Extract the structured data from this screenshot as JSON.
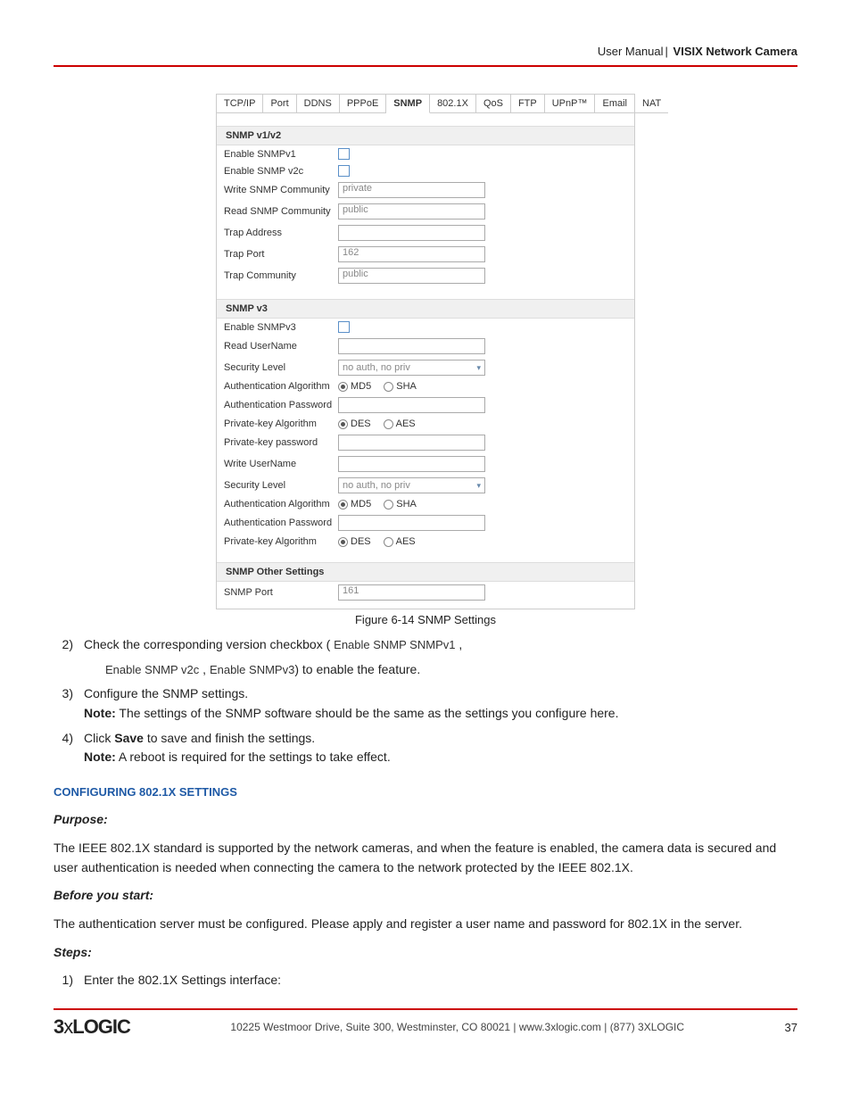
{
  "header": {
    "left": "User Manual",
    "sep": "|",
    "right": "VISIX Network Camera"
  },
  "tabs": [
    "TCP/IP",
    "Port",
    "DDNS",
    "PPPoE",
    "SNMP",
    "802.1X",
    "QoS",
    "FTP",
    "UPnP™",
    "Email",
    "NAT"
  ],
  "active_tab": "SNMP",
  "panel": {
    "s1": {
      "title": "SNMP v1/v2",
      "r1": "Enable SNMPv1",
      "r2": "Enable SNMP v2c",
      "r3": "Write SNMP Community",
      "v3": "private",
      "r4": "Read SNMP Community",
      "v4": "public",
      "r5": "Trap Address",
      "r6": "Trap Port",
      "v6": "162",
      "r7": "Trap Community",
      "v7": "public"
    },
    "s2": {
      "title": "SNMP v3",
      "r1": "Enable SNMPv3",
      "r2": "Read UserName",
      "r3": "Security Level",
      "v3": "no auth, no priv",
      "r4": "Authentication Algorithm",
      "a": "MD5",
      "b": "SHA",
      "r5": "Authentication Password",
      "r6": "Private-key Algorithm",
      "c": "DES",
      "d": "AES",
      "r7": "Private-key password",
      "r8": "Write UserName",
      "r9": "Security Level",
      "v9": "no auth, no priv",
      "r10": "Authentication Algorithm",
      "r11": "Authentication Password",
      "r12": "Private-key Algorithm"
    },
    "s3": {
      "title": "SNMP Other Settings",
      "r1": "SNMP Port",
      "v1": "161"
    }
  },
  "caption_pre": "Figure 6-14 ",
  "caption": "SNMP Settings",
  "li2a": "Check the corresponding version checkbox ( ",
  "li2_img1": "Enable SNMP SNMPv1",
  "li2b": " ,",
  "li2_line2_img1": "Enable SNMP v2c",
  "li2_line2_sep": " ,     ",
  "li2_line2_img2": "Enable SNMPv3",
  "li2_line2_end": ") to enable the feature.",
  "li3": "Configure the SNMP settings.",
  "note_label": "Note:",
  "li3_note": " The settings of the SNMP software should be the same as the settings you configure here.",
  "li4_a": "Click ",
  "li4_b": "Save",
  "li4_c": " to save and finish the settings.",
  "li4_note": " A reboot is required for the settings to take effect.",
  "sect": "CONFIGURING 802.1X SETTINGS",
  "purpose_h": "Purpose:",
  "purpose": "The IEEE 802.1X standard is supported by the network cameras, and when the feature is enabled, the camera data is secured and user authentication is needed when connecting the camera to the network protected by the IEEE 802.1X.",
  "before_h": "Before you start:",
  "before": "The authentication server must be configured. Please apply and register a user name and password for 802.1X in the server.",
  "steps_h": "Steps:",
  "step1": "Enter the 802.1X Settings interface:",
  "footer_addr": "10225 Westmoor Drive, Suite 300, Westminster, CO 80021 | www.3xlogic.com | (877) 3XLOGIC",
  "page_num": "37",
  "logo_a": "3",
  "logo_b": "x",
  "logo_c": "LOGIC"
}
